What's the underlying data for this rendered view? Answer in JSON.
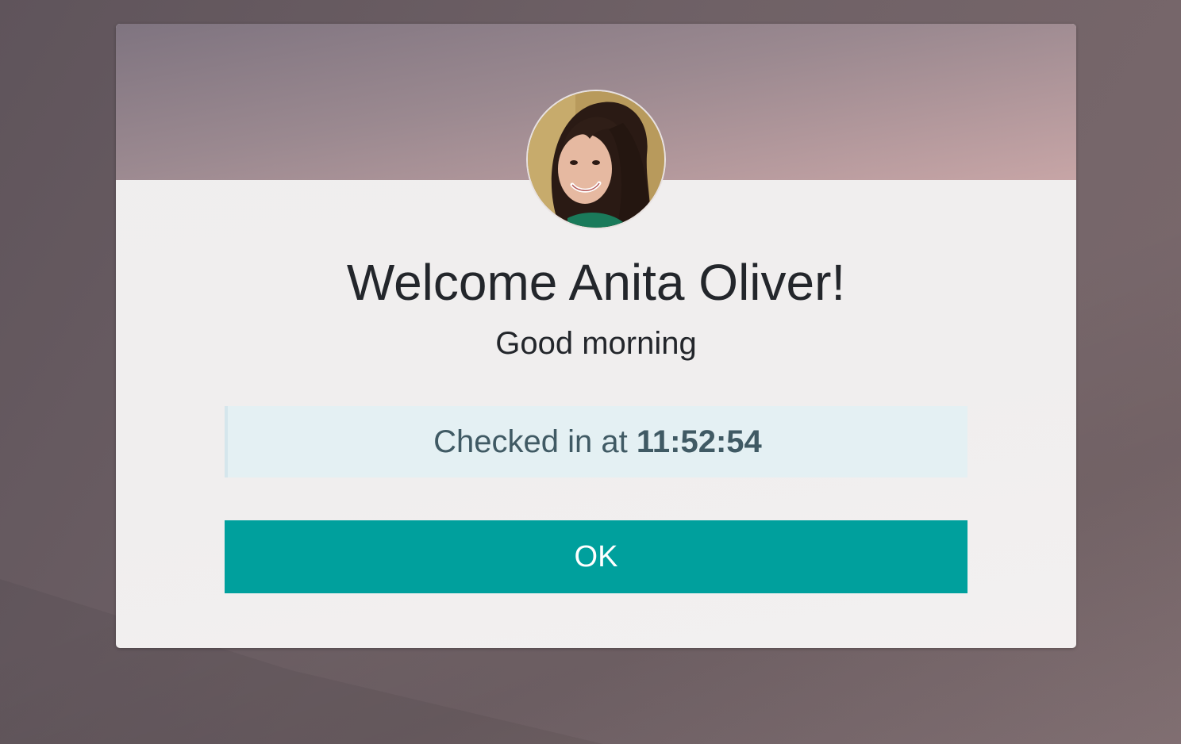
{
  "dialog": {
    "welcome_prefix": "Welcome",
    "employee_name": "Anita Oliver",
    "welcome_suffix": "!",
    "greeting": "Good morning",
    "checkin_label": "Checked in at",
    "checkin_time": "11:52:54",
    "ok_label": "OK"
  },
  "colors": {
    "ok_button": "#00a09d",
    "checkin_box_bg": "#e4f0f3",
    "checkin_text": "#405a64",
    "header_gradient_start": "#7f7480",
    "header_gradient_end": "#c7a5a6"
  }
}
